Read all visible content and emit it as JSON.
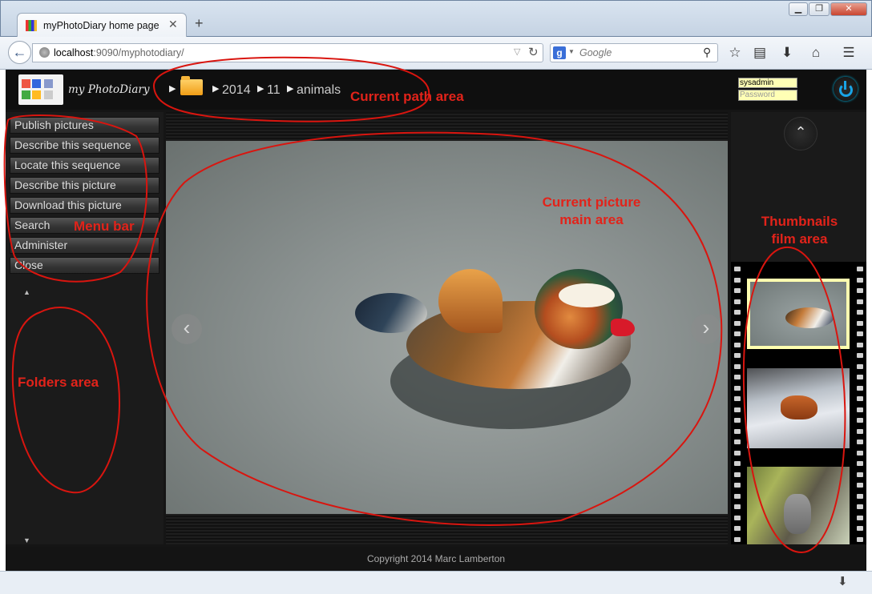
{
  "browser": {
    "tab_title": "myPhotoDiary home page",
    "url_host": "localhost",
    "url_port_path": ":9090/myphotodiary/",
    "search_engine_glyph": "g",
    "search_placeholder": "Google",
    "icons": [
      "back-arrow-icon",
      "globe-icon",
      "reload-icon",
      "search-icon",
      "star-icon",
      "clipboard-icon",
      "download-icon",
      "home-icon",
      "hamburger-menu-icon"
    ]
  },
  "app": {
    "logo_text": "my PhotoDiary",
    "breadcrumbs": [
      "2014",
      "11",
      "animals"
    ],
    "login": {
      "username": "sysadmin",
      "password_placeholder": "Password"
    },
    "menu": [
      "Publish pictures",
      "Describe this sequence",
      "Locate this sequence",
      "Describe this picture",
      "Download this picture",
      "Search",
      "Administer",
      "Close"
    ],
    "footer": "Copyright 2014 Marc Lamberton",
    "thumbnails": [
      "mandarin-duck",
      "red-fox",
      "lemur"
    ],
    "selected_thumbnail": 0
  },
  "annotations": {
    "path": "Current path area",
    "menu": "Menu bar",
    "picture": [
      "Current picture",
      "main area"
    ],
    "thumbs": [
      "Thumbnails",
      "film area"
    ],
    "folders": "Folders area",
    "color": "#e2231a"
  }
}
